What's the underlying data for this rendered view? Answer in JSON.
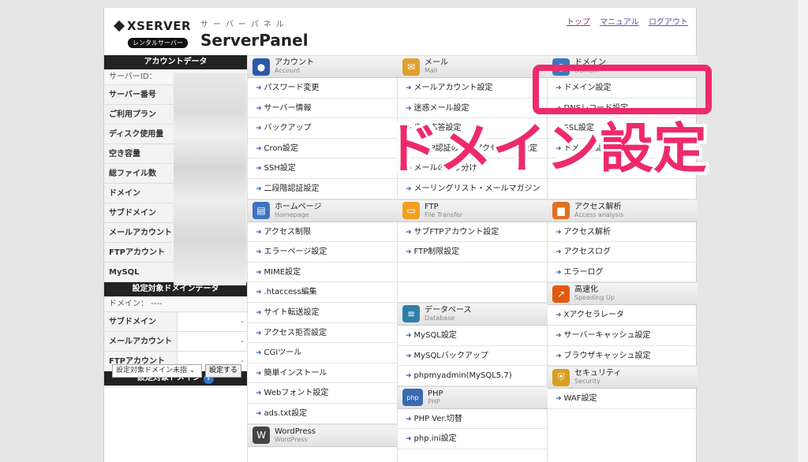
{
  "header": {
    "logo_brand": "XSERVER",
    "logo_sub": "レンタルサーバー",
    "title_kana": "サーバーパネル",
    "title": "ServerPanel",
    "links": [
      "トップ",
      "マニュアル",
      "ログアウト"
    ]
  },
  "sidebar": {
    "account_header": "アカウントデータ",
    "server_id_label": "サーバーID：",
    "rows": [
      "サーバー番号",
      "ご利用プラン",
      "ディスク使用量",
      "空き容量",
      "総ファイル数",
      "ドメイン",
      "サブドメイン",
      "メールアカウント",
      "FTPアカウント",
      "MySQL"
    ],
    "target_header": "設定対象ドメインデータ",
    "domain_info": "ドメイン： ----",
    "target_rows": [
      {
        "label": "サブドメイン",
        "value": "-"
      },
      {
        "label": "メールアカウント",
        "value": "-"
      },
      {
        "label": "FTPアカウント",
        "value": "-"
      }
    ],
    "select_header": "設定対象ドメイン",
    "select_value": "設定対象ドメイン未指",
    "select_button": "設定する"
  },
  "columns": [
    {
      "sections": [
        {
          "title": "アカウント",
          "sub": "Account",
          "icon": "user-icon",
          "color": "#2b5aa8",
          "items": [
            "パスワード変更",
            "サーバー情報",
            "バックアップ",
            "Cron設定",
            "SSH設定",
            "二段階認証設定"
          ]
        },
        {
          "title": "ホームページ",
          "sub": "Homepage",
          "icon": "homepage-icon",
          "color": "#3f74c0",
          "items": [
            "アクセス制限",
            "エラーページ設定",
            "MIME設定",
            ".htaccess編集",
            "サイト転送設定",
            "アクセス拒否設定",
            "CGIツール",
            "簡単インストール",
            "Webフォント設定",
            "ads.txt設定"
          ]
        },
        {
          "title": "WordPress",
          "sub": "WordPress",
          "icon": "wordpress-icon",
          "color": "#444444",
          "items": []
        }
      ]
    },
    {
      "sections": [
        {
          "title": "メール",
          "sub": "Mail",
          "icon": "mail-icon",
          "color": "#e0a030",
          "items": [
            "メールアカウント設定",
            "迷惑メール設定",
            "自動応答設定",
            "SMTP認証の国外アクセス制限設定",
            "メールの振り分け",
            "メーリングリスト・メールマガジン"
          ]
        },
        {
          "title": "FTP",
          "sub": "File Transfer",
          "icon": "folder-icon",
          "color": "#f0a020",
          "items": [
            "サブFTPアカウント設定",
            "FTP制限設定",
            "",
            ""
          ]
        },
        {
          "title": "データベース",
          "sub": "Database",
          "icon": "database-icon",
          "color": "#2f7fa8",
          "items": [
            "MySQL設定",
            "MySQLバックアップ",
            "phpmyadmin(MySQL5.7)"
          ]
        },
        {
          "title": "PHP",
          "sub": "PHP",
          "icon": "php-icon",
          "color": "#3a6ab0",
          "items": [
            "PHP Ver.切替",
            "php.ini設定"
          ]
        }
      ]
    },
    {
      "sections": [
        {
          "title": "ドメイン",
          "sub": "Domain",
          "icon": "globe-icon",
          "color": "#3a7ac0",
          "items": [
            "ドメイン設定",
            "DNSレコード設定",
            "SSL設定",
            "ドメイン認証",
            "",
            ""
          ]
        },
        {
          "title": "アクセス解析",
          "sub": "Access analysis",
          "icon": "chart-icon",
          "color": "#e07020",
          "items": [
            "アクセス解析",
            "アクセスログ",
            "エラーログ"
          ]
        },
        {
          "title": "高速化",
          "sub": "Speeding Up",
          "icon": "speed-icon",
          "color": "#e05a10",
          "items": [
            "Xアクセラレータ",
            "サーバーキャッシュ設定",
            "ブラウザキャッシュ設定"
          ]
        },
        {
          "title": "セキュリティ",
          "sub": "Security",
          "icon": "shield-icon",
          "color": "#d8a020",
          "items": [
            "WAF設定"
          ]
        }
      ]
    }
  ],
  "overlay": {
    "caption": "ドメイン設定",
    "highlight_color": "#ee2a6a"
  }
}
